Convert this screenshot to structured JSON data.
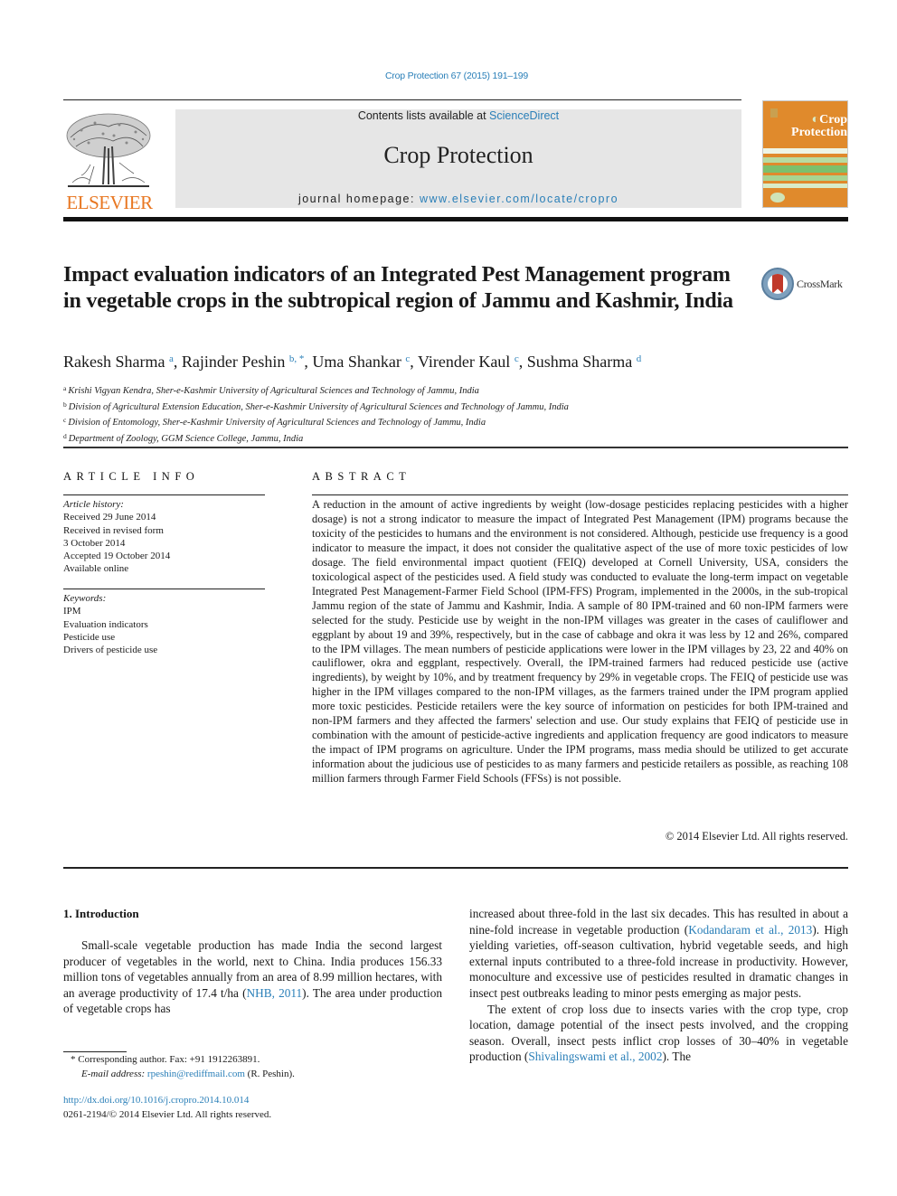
{
  "header": {
    "citation": "Crop Protection 67 (2015) 191–199",
    "publisher_name": "ELSEVIER",
    "contents_prefix": "Contents lists available at ",
    "contents_link": "ScienceDirect",
    "journal_title": "Crop Protection",
    "homepage_prefix": "journal homepage: ",
    "homepage_link": "www.elsevier.com/locate/cropro",
    "cover_title_line1": "Crop",
    "cover_title_line2": "Protection",
    "crossmark_label": "CrossMark",
    "colors": {
      "link": "#2a7fb8",
      "elsevier_orange": "#e87722",
      "cover_orange": "#e08a2c",
      "header_bg": "#e6e6e6"
    }
  },
  "article": {
    "title": "Impact evaluation indicators of an Integrated Pest Management program in vegetable crops in the subtropical region of Jammu and Kashmir, India",
    "authors": [
      {
        "name": "Rakesh Sharma",
        "sup": "a"
      },
      {
        "name": "Rajinder Peshin",
        "sup": "b, *"
      },
      {
        "name": "Uma Shankar",
        "sup": "c"
      },
      {
        "name": "Virender Kaul",
        "sup": "c"
      },
      {
        "name": "Sushma Sharma",
        "sup": "d"
      }
    ],
    "affiliations": [
      {
        "sup": "a",
        "text": "Krishi Vigyan Kendra, Sher-e-Kashmir University of Agricultural Sciences and Technology of Jammu, India"
      },
      {
        "sup": "b",
        "text": "Division of Agricultural Extension Education, Sher-e-Kashmir University of Agricultural Sciences and Technology of Jammu, India"
      },
      {
        "sup": "c",
        "text": "Division of Entomology, Sher-e-Kashmir University of Agricultural Sciences and Technology of Jammu, India"
      },
      {
        "sup": "d",
        "text": "Department of Zoology, GGM Science College, Jammu, India"
      }
    ]
  },
  "article_info": {
    "heading": "ARTICLE INFO",
    "history_label": "Article history:",
    "history": [
      "Received 29 June 2014",
      "Received in revised form",
      "3 October 2014",
      "Accepted 19 October 2014",
      "Available online"
    ],
    "keywords_label": "Keywords:",
    "keywords": [
      "IPM",
      "Evaluation indicators",
      "Pesticide use",
      "Drivers of pesticide use"
    ]
  },
  "abstract": {
    "heading": "ABSTRACT",
    "text": "A reduction in the amount of active ingredients by weight (low-dosage pesticides replacing pesticides with a higher dosage) is not a strong indicator to measure the impact of Integrated Pest Management (IPM) programs because the toxicity of the pesticides to humans and the environment is not considered. Although, pesticide use frequency is a good indicator to measure the impact, it does not consider the qualitative aspect of the use of more toxic pesticides of low dosage. The field environmental impact quotient (FEIQ) developed at Cornell University, USA, considers the toxicological aspect of the pesticides used. A field study was conducted to evaluate the long-term impact on vegetable Integrated Pest Management-Farmer Field School (IPM-FFS) Program, implemented in the 2000s, in the sub-tropical Jammu region of the state of Jammu and Kashmir, India. A sample of 80 IPM-trained and 60 non-IPM farmers were selected for the study. Pesticide use by weight in the non-IPM villages was greater in the cases of cauliflower and eggplant by about 19 and 39%, respectively, but in the case of cabbage and okra it was less by 12 and 26%, compared to the IPM villages. The mean numbers of pesticide applications were lower in the IPM villages by 23, 22 and 40% on cauliflower, okra and eggplant, respectively. Overall, the IPM-trained farmers had reduced pesticide use (active ingredients), by weight by 10%, and by treatment frequency by 29% in vegetable crops. The FEIQ of pesticide use was higher in the IPM villages compared to the non-IPM villages, as the farmers trained under the IPM program applied more toxic pesticides. Pesticide retailers were the key source of information on pesticides for both IPM-trained and non-IPM farmers and they affected the farmers' selection and use. Our study explains that FEIQ of pesticide use in combination with the amount of pesticide-active ingredients and application frequency are good indicators to measure the impact of IPM programs on agriculture. Under the IPM programs, mass media should be utilized to get accurate information about the judicious use of pesticides to as many farmers and pesticide retailers as possible, as reaching 108 million farmers through Farmer Field Schools (FFSs) is not possible.",
    "copyright": "© 2014 Elsevier Ltd. All rights reserved."
  },
  "introduction": {
    "heading": "1.  Introduction",
    "left_p1_a": "Small-scale vegetable production has made India the second largest producer of vegetables in the world, next to China. India produces 156.33 million tons of vegetables annually from an area of 8.99 million hectares, with an average productivity of 17.4 t/ha (",
    "left_p1_link": "NHB, 2011",
    "left_p1_b": "). The area under production of vegetable crops has",
    "right_p1_a": "increased about three-fold in the last six decades. This has resulted in about a nine-fold increase in vegetable production (",
    "right_p1_link": "Kodandaram et al., 2013",
    "right_p1_b": "). High yielding varieties, off-season cultivation, hybrid vegetable seeds, and high external inputs contributed to a three-fold increase in productivity. However, monoculture and excessive use of pesticides resulted in dramatic changes in insect pest outbreaks leading to minor pests emerging as major pests.",
    "right_p2_a": "The extent of crop loss due to insects varies with the crop type, crop location, damage potential of the insect pests involved, and the cropping season. Overall, insect pests inflict crop losses of 30–40% in vegetable production (",
    "right_p2_link": "Shivalingswami et al., 2002",
    "right_p2_b": "). The"
  },
  "footnotes": {
    "corresponding": "* Corresponding author. Fax: +91 1912263891.",
    "email_label": "E-mail address: ",
    "email": "rpeshin@rediffmail.com",
    "email_suffix": " (R. Peshin).",
    "doi": "http://dx.doi.org/10.1016/j.cropro.2014.10.014",
    "issn_copyright": "0261-2194/© 2014 Elsevier Ltd. All rights reserved."
  }
}
